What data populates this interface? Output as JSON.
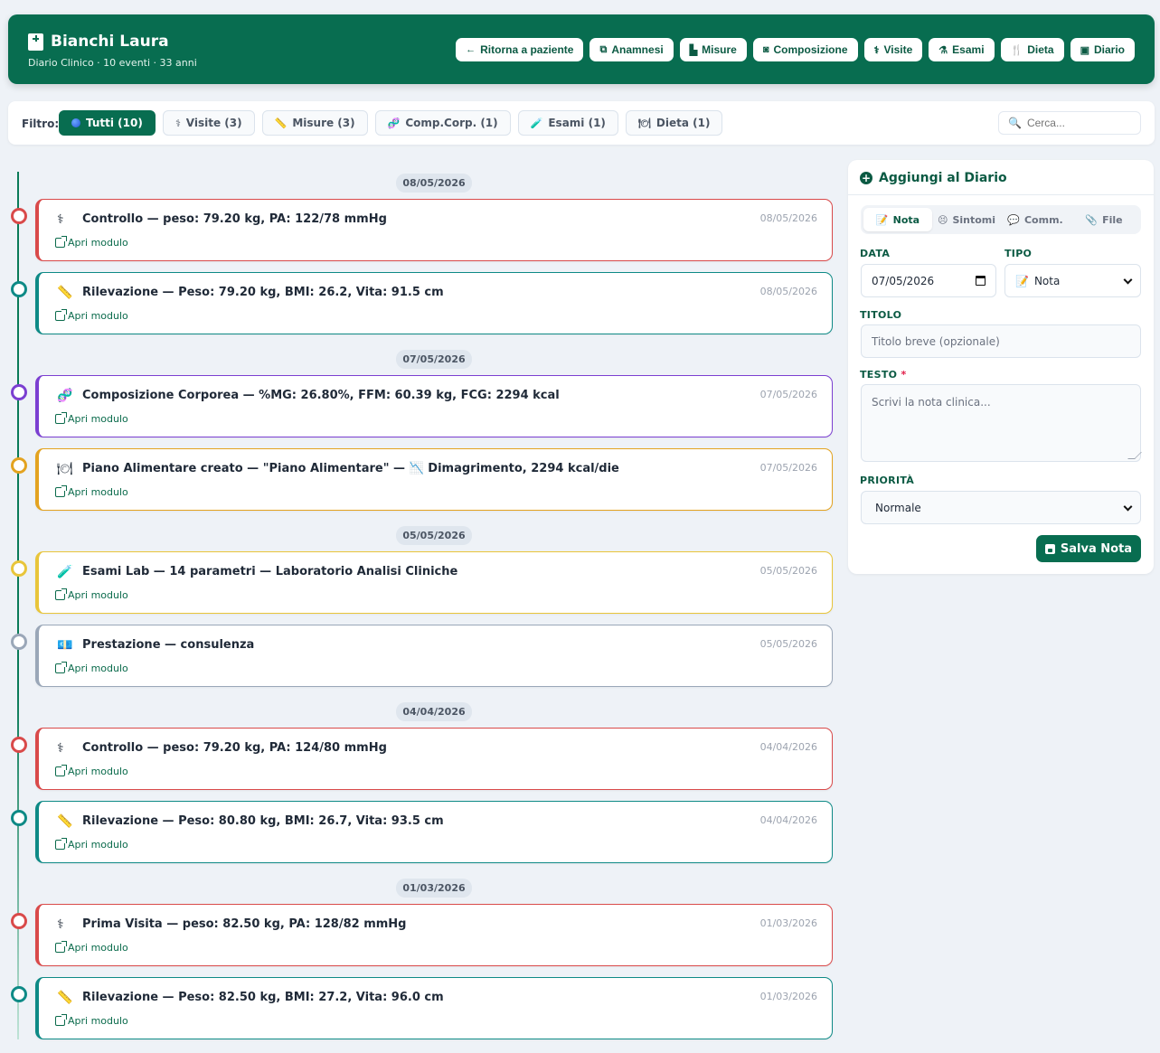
{
  "header": {
    "name": "Bianchi Laura",
    "subtitle": "Diario Clinico · 10 eventi · 33 anni",
    "buttons": [
      {
        "label": "Ritorna a paziente",
        "icon": "←"
      },
      {
        "label": "Anamnesi",
        "icon": "⧉"
      },
      {
        "label": "Misure",
        "icon": "▙"
      },
      {
        "label": "Composizione",
        "icon": "◙"
      },
      {
        "label": "Visite",
        "icon": "⚕"
      },
      {
        "label": "Esami",
        "icon": "⚗"
      },
      {
        "label": "Dieta",
        "icon": "🍴"
      },
      {
        "label": "Diario",
        "icon": "▣"
      }
    ]
  },
  "filter": {
    "label": "Filtro:",
    "buttons": [
      {
        "label": "Tutti (10)",
        "icon": ""
      },
      {
        "label": "Visite (3)",
        "icon": "⚕"
      },
      {
        "label": "Misure (3)",
        "icon": "📏"
      },
      {
        "label": "Comp.Corp. (1)",
        "icon": "🧬"
      },
      {
        "label": "Esami (1)",
        "icon": "🧪"
      },
      {
        "label": "Dieta (1)",
        "icon": "🍽"
      }
    ],
    "search_placeholder": "Cerca..."
  },
  "colors": {
    "visita": "#d94a4a",
    "misura": "#0e8a86",
    "composizione": "#7b3fd1",
    "dieta": "#e3a320",
    "esami": "#e8c53a",
    "prestazione": "#9aa7b8",
    "accent": "#086d50"
  },
  "timeline": {
    "dates": [
      "08/05/2026",
      "07/05/2026",
      "05/05/2026",
      "04/04/2026",
      "01/03/2026"
    ],
    "open_label": "Apri modulo",
    "events": [
      {
        "kind": "visita",
        "icon": "⚕",
        "title": "Controllo — peso: 79.20 kg, PA: 122/78 mmHg",
        "date": "08/05/2026"
      },
      {
        "kind": "misura",
        "icon": "📏",
        "title": "Rilevazione — Peso: 79.20 kg, BMI: 26.2, Vita: 91.5 cm",
        "date": "08/05/2026"
      },
      {
        "kind": "composizione",
        "icon": "🧬",
        "title": "Composizione Corporea — %MG: 26.80%, FFM: 60.39 kg, FCG: 2294 kcal",
        "date": "07/05/2026"
      },
      {
        "kind": "dieta",
        "icon": "🍽",
        "title": "Piano Alimentare creato — \"Piano Alimentare\" — 📉 Dimagrimento, 2294 kcal/die",
        "date": "07/05/2026"
      },
      {
        "kind": "esami",
        "icon": "🧪",
        "title": "Esami Lab — 14 parametri — Laboratorio Analisi Cliniche",
        "date": "05/05/2026"
      },
      {
        "kind": "prestazione",
        "icon": "💶",
        "title": "Prestazione — consulenza",
        "date": "05/05/2026"
      },
      {
        "kind": "visita",
        "icon": "⚕",
        "title": "Controllo — peso: 79.20 kg, PA: 124/80 mmHg",
        "date": "04/04/2026"
      },
      {
        "kind": "misura",
        "icon": "📏",
        "title": "Rilevazione — Peso: 80.80 kg, BMI: 26.7, Vita: 93.5 cm",
        "date": "04/04/2026"
      },
      {
        "kind": "visita",
        "icon": "⚕",
        "title": "Prima Visita — peso: 82.50 kg, PA: 128/82 mmHg",
        "date": "01/03/2026"
      },
      {
        "kind": "misura",
        "icon": "📏",
        "title": "Rilevazione — Peso: 82.50 kg, BMI: 27.2, Vita: 96.0 cm",
        "date": "01/03/2026"
      }
    ]
  },
  "panel": {
    "title": "Aggiungi al Diario",
    "tabs": [
      {
        "label": "Nota",
        "icon": "📝"
      },
      {
        "label": "Sintomi",
        "icon": "😣"
      },
      {
        "label": "Comm.",
        "icon": "💬"
      },
      {
        "label": "File",
        "icon": "📎"
      }
    ],
    "data_label": "DATA",
    "data_value": "07/05/2026",
    "tipo_label": "TIPO",
    "tipo_value": "Nota",
    "tipo_icon": "📝",
    "titolo_label": "TITOLO",
    "titolo_placeholder": "Titolo breve (opzionale)",
    "testo_label": "TESTO",
    "testo_required": "*",
    "testo_placeholder": "Scrivi la nota clinica...",
    "priorita_label": "PRIORITÀ",
    "priorita_value": "Normale",
    "save_label": "Salva Nota"
  }
}
